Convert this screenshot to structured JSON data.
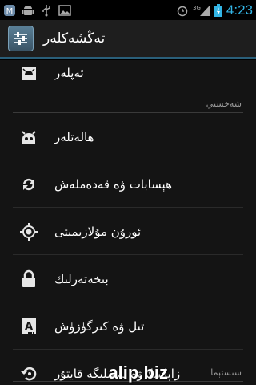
{
  "status_bar": {
    "left_icons": [
      "messenger-icon",
      "android-icon",
      "usb-icon",
      "image-icon"
    ],
    "network": "3G",
    "time": "4:23"
  },
  "action_bar": {
    "title": "تەڭشەكلەر",
    "icon": "settings-icon"
  },
  "items": [
    {
      "label": "ئەپلەر",
      "icon": "apps-icon"
    },
    {
      "label": "ھالەتلەر",
      "icon": "android-head-icon"
    },
    {
      "label": "ھېسابات ۋە قەدەملەش",
      "icon": "sync-icon"
    },
    {
      "label": "ئورۇن مۇلازىمىتى",
      "icon": "location-icon"
    },
    {
      "label": "بىخەتەرلىك",
      "icon": "lock-icon"
    },
    {
      "label": "تىل ۋە كىرگۈزۈش",
      "icon": "language-icon"
    },
    {
      "label": "زاپاسلا ۋە ئەسلىگە قايتۇر",
      "icon": "restore-icon"
    }
  ],
  "sections": {
    "personal": "شەخسىي",
    "system": "سىستېما"
  },
  "watermark": "alip.biz",
  "colors": {
    "accent": "#33b5e5",
    "background": "#141414",
    "divider": "#2a2a2a"
  }
}
